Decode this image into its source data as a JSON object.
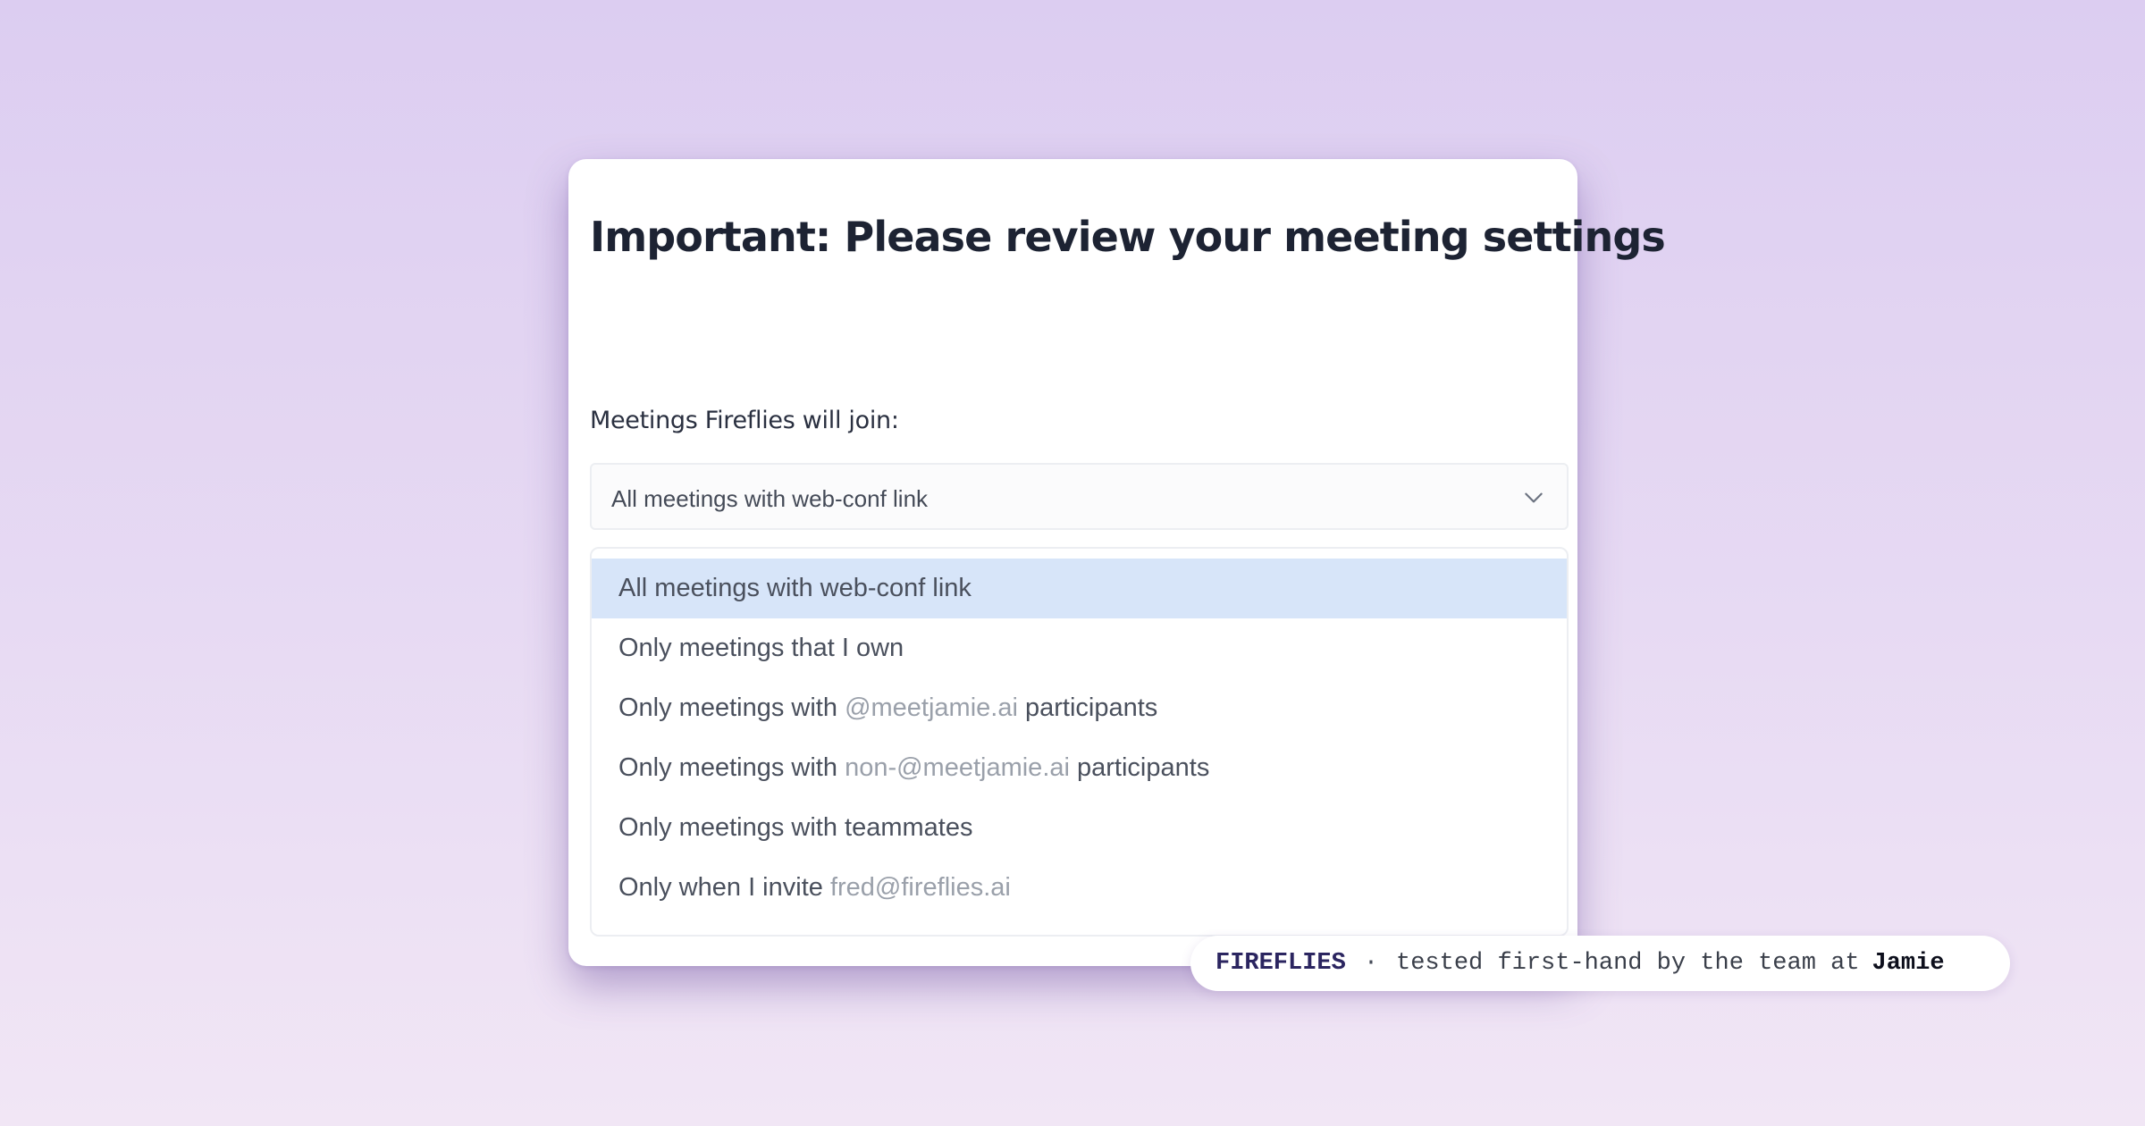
{
  "dialog": {
    "title": "Important: Please review your meeting settings",
    "field_label": "Meetings Fireflies will join:",
    "select": {
      "value": "All meetings with web-conf link",
      "icon": "chevron-down-icon"
    },
    "options": [
      {
        "label": "All meetings with web-conf link",
        "selected": true
      },
      {
        "prefix": "Only meetings that I own"
      },
      {
        "prefix": "Only meetings with",
        "muted": "@meetjamie.ai",
        "suffix": "participants"
      },
      {
        "prefix": "Only meetings with",
        "muted": "non-@meetjamie.ai",
        "suffix": "participants"
      },
      {
        "prefix": "Only meetings with teammates"
      },
      {
        "prefix": "Only when I invite",
        "muted": "fred@fireflies.ai"
      }
    ]
  },
  "badge": {
    "brand": "FIREFLIES",
    "separator": "·",
    "text": "tested first-hand by the team at",
    "company": "Jamie"
  },
  "colors": {
    "selected_option_bg": "#d7e5f9",
    "muted_text": "#9aa0aa",
    "title_text": "#1d2333"
  }
}
